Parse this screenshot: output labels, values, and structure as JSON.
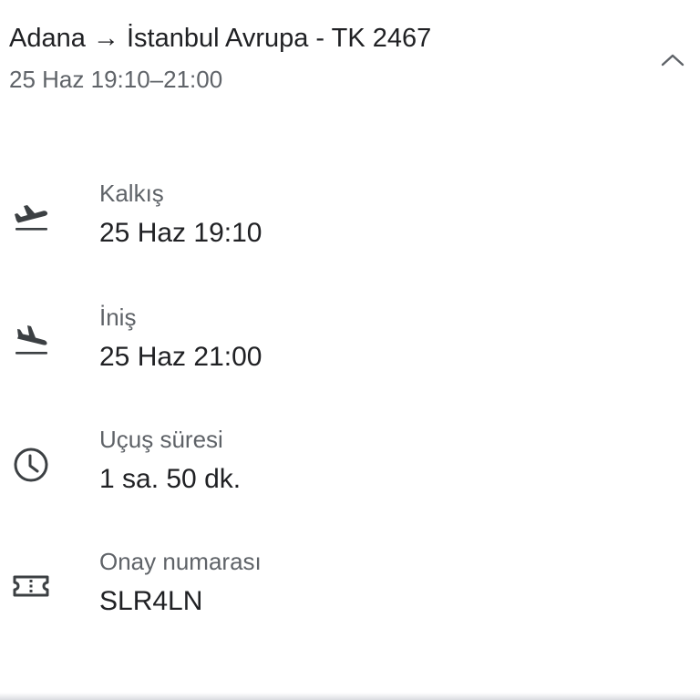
{
  "header": {
    "title": "Adana → İstanbul Avrupa - TK 2467",
    "subtitle": "25 Haz 19:10–21:00",
    "collapse_icon": "chevron-up-icon"
  },
  "details": [
    {
      "icon": "flight-takeoff-icon",
      "label": "Kalkış",
      "value": "25 Haz 19:10"
    },
    {
      "icon": "flight-land-icon",
      "label": "İniş",
      "value": "25 Haz 21:00"
    },
    {
      "icon": "clock-icon",
      "label": "Uçuş süresi",
      "value": "1 sa. 50 dk."
    },
    {
      "icon": "ticket-icon",
      "label": "Onay numarası",
      "value": "SLR4LN"
    }
  ],
  "colors": {
    "primary_text": "#202124",
    "secondary_text": "#5f6368",
    "icon": "#3c4043"
  }
}
